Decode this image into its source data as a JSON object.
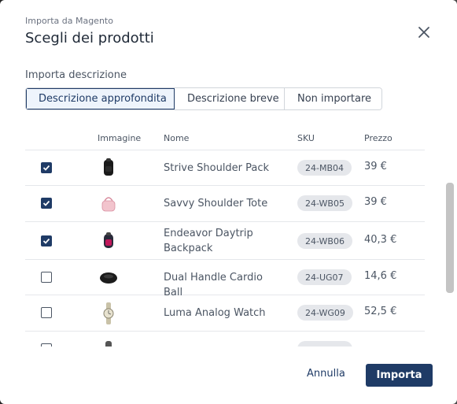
{
  "header": {
    "subtitle": "Importa da Magento",
    "title": "Scegli dei prodotti"
  },
  "description": {
    "label": "Importa descrizione",
    "options": [
      "Descrizione approfondita",
      "Descrizione breve",
      "Non importare"
    ],
    "selected": "Descrizione approfondita"
  },
  "table": {
    "columns": {
      "image": "Immagine",
      "name": "Nome",
      "sku": "SKU",
      "price": "Prezzo"
    },
    "rows": [
      {
        "checked": true,
        "name": "Strive Shoulder Pack",
        "sku": "24-MB04",
        "price": "39 €",
        "icon": "black-backpack-icon"
      },
      {
        "checked": true,
        "name": "Savvy Shoulder Tote",
        "sku": "24-WB05",
        "price": "39 €",
        "icon": "pink-tote-bag-icon"
      },
      {
        "checked": true,
        "name": "Endeavor Daytrip Backpack",
        "sku": "24-WB06",
        "price": "40,3 €",
        "icon": "daytrip-backpack-icon"
      },
      {
        "checked": false,
        "name": "Dual Handle Cardio Ball",
        "sku": "24-UG07",
        "price": "14,6 €",
        "icon": "cardio-ball-icon"
      },
      {
        "checked": false,
        "name": "Luma Analog Watch",
        "sku": "24-WG09",
        "price": "52,5 €",
        "icon": "analog-watch-icon"
      }
    ]
  },
  "footer": {
    "cancel_label": "Annulla",
    "import_label": "Importa"
  },
  "colors": {
    "primary": "#1f3b66",
    "selected_bg": "#eef4fc"
  }
}
